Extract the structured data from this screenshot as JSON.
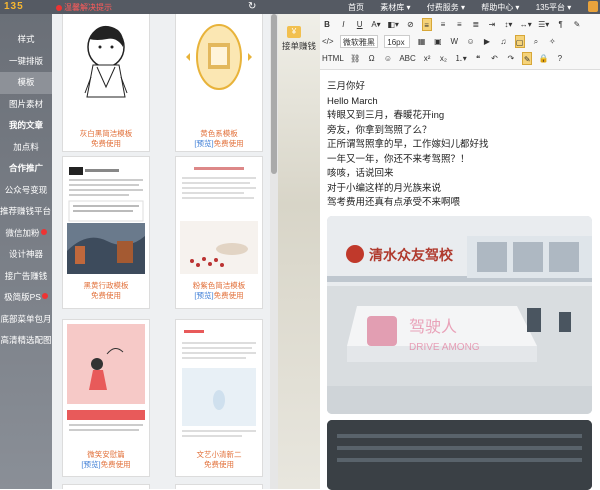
{
  "topbar": {
    "logo": "135",
    "warning": "温馨解决提示",
    "refresh_icon": "refresh-icon",
    "nav": [
      "首页",
      "素材库 ▾",
      "付费服务 ▾",
      "帮助中心 ▾",
      "135平台 ▾"
    ]
  },
  "sidebar": {
    "items": [
      {
        "label": "样式"
      },
      {
        "label": "一键排版"
      },
      {
        "label": "模板"
      },
      {
        "label": "图片素材"
      },
      {
        "label": "我的文章"
      },
      {
        "label": "加点料"
      },
      {
        "label": "合作推广"
      },
      {
        "label": "公众号变现"
      },
      {
        "label": "推荐赚钱平台"
      },
      {
        "label": "微信加粉"
      },
      {
        "label": "设计神器"
      },
      {
        "label": "接广告赚钱"
      },
      {
        "label": "极简版PS"
      },
      {
        "label": "底部菜单包月"
      },
      {
        "label": "高清精选配图"
      }
    ]
  },
  "gallery": {
    "cards": [
      {
        "title": "灰白黑简洁模板",
        "label": "免费使用"
      },
      {
        "title": "黄色系模板",
        "prefix": "[预览]",
        "label": "免费使用"
      },
      {
        "title": "黑黄行政模板",
        "label": "免费使用"
      },
      {
        "title": "粉紫色简洁模板",
        "prefix": "[预览]",
        "label": "免费使用"
      },
      {
        "title": "微笑安慰篇",
        "prefix": "[预览]",
        "label": "免费使用"
      },
      {
        "title": "文艺小清新二",
        "label": "免费使用"
      }
    ]
  },
  "mid": {
    "label": "接单赚钱"
  },
  "toolbar": {
    "font_family": "微软雅黑",
    "font_size": "16px"
  },
  "editor": {
    "lines": [
      "三月你好",
      "Hello March",
      "转眼又到三月，春暖花开ing",
      "旁友，你拿到驾照了么？",
      "正所谓驾照拿的早，工作嫁妇儿都好找",
      "一年又一年，你还不来考驾照？！",
      "咳咳，话说回来",
      "对于小编这样的月光族来说",
      "驾考费用还真有点承受不来啊喂"
    ],
    "sign_text": "清水众友驾校",
    "watermark": "DRIVE AMONG",
    "watermark_cn": "驾驶人"
  }
}
